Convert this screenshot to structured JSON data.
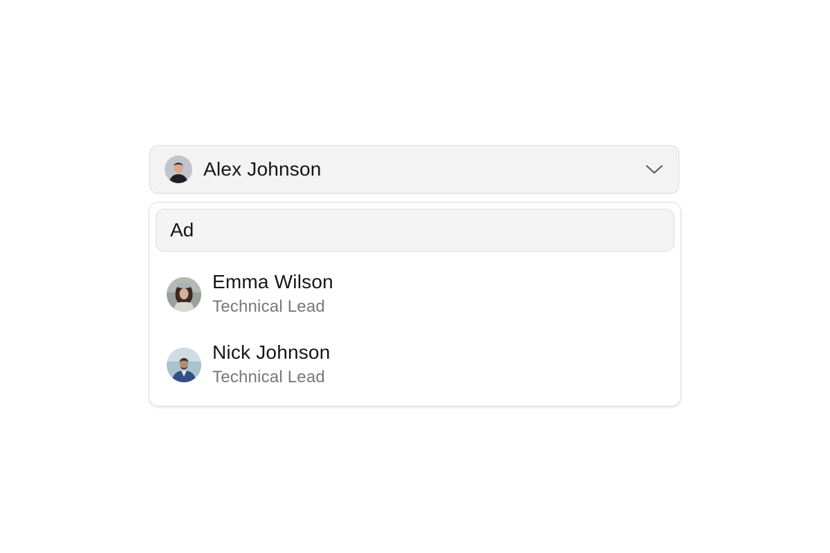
{
  "select": {
    "selected": {
      "name": "Alex Johnson",
      "avatar_icon": "person-avatar-icon"
    },
    "chevron_icon": "chevron-down-icon"
  },
  "search": {
    "value": "Ad"
  },
  "options": [
    {
      "name": "Emma Wilson",
      "role": "Technical Lead",
      "avatar_icon": "person-avatar-icon"
    },
    {
      "name": "Nick Johnson",
      "role": "Technical Lead",
      "avatar_icon": "person-avatar-icon"
    }
  ],
  "colors": {
    "trigger_bg": "#f3f3f3",
    "border": "#dddddd",
    "text": "#151515",
    "muted_text": "#777777"
  }
}
